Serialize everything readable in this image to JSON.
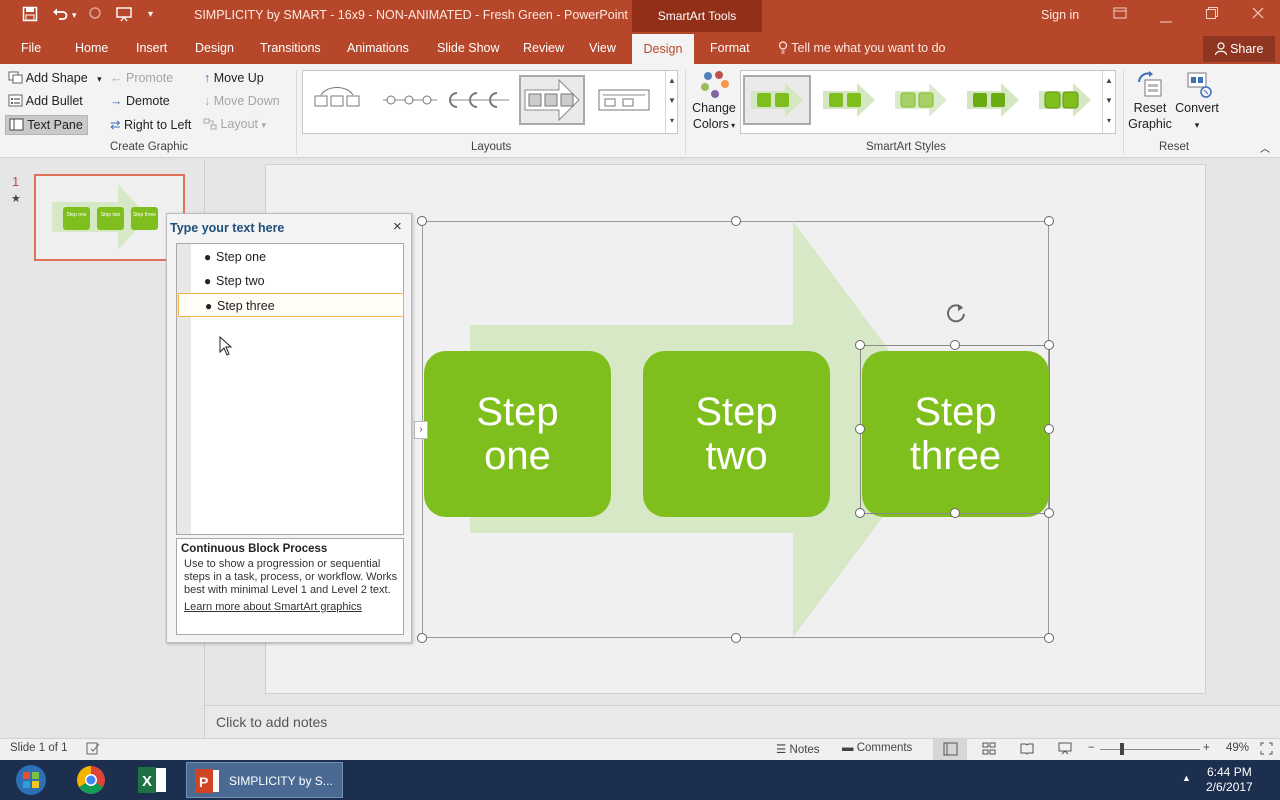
{
  "window": {
    "title": "SIMPLICITY by SMART - 16x9 - NON-ANIMATED - Fresh Green  -  PowerPoint",
    "context_tools": "SmartArt Tools",
    "sign_in": "Sign in",
    "accent_color": "#b7472a"
  },
  "tabs": {
    "file": "File",
    "home": "Home",
    "insert": "Insert",
    "design": "Design",
    "transitions": "Transitions",
    "animations": "Animations",
    "slideshow": "Slide Show",
    "review": "Review",
    "view": "View",
    "smartart_design": "Design",
    "format": "Format",
    "tell_me": "Tell me what you want to do",
    "share": "Share"
  },
  "ribbon": {
    "create_graphic": {
      "label": "Create Graphic",
      "add_shape": "Add Shape",
      "add_bullet": "Add Bullet",
      "text_pane": "Text Pane",
      "promote": "Promote",
      "demote": "Demote",
      "right_to_left": "Right to Left",
      "move_up": "Move Up",
      "move_down": "Move Down",
      "layout": "Layout"
    },
    "layouts": {
      "label": "Layouts"
    },
    "smartart_styles": {
      "label": "SmartArt Styles",
      "change_colors_1": "Change",
      "change_colors_2": "Colors"
    },
    "reset": {
      "label": "Reset",
      "reset_graphic_1": "Reset",
      "reset_graphic_2": "Graphic",
      "convert": "Convert"
    }
  },
  "thumbnails": {
    "slide_number": "1",
    "star": "★",
    "boxes": [
      "Step one",
      "Step two",
      "Step three"
    ]
  },
  "smartart": {
    "steps": [
      {
        "line1": "Step",
        "line2": "one"
      },
      {
        "line1": "Step",
        "line2": "two"
      },
      {
        "line1": "Step",
        "line2": "three"
      }
    ],
    "fill_color": "#7fbf1d",
    "arrow_color": "#d6e8c6"
  },
  "text_pane": {
    "title": "Type your text here",
    "close": "×",
    "items": [
      "Step one",
      "Step two",
      "Step three"
    ],
    "layout_name": "Continuous Block Process",
    "layout_desc": "Use to show a progression or sequential steps in a task, process, or workflow. Works best with minimal Level 1 and Level 2 text.",
    "learn_more": "Learn more about SmartArt graphics"
  },
  "notes": {
    "placeholder": "Click to add notes"
  },
  "status_bar": {
    "slide_info": "Slide 1 of 1",
    "notes": "Notes",
    "comments": "Comments",
    "zoom": "49%"
  },
  "taskbar": {
    "powerpoint_label": "SIMPLICITY by S...",
    "time": "6:44 PM",
    "date": "2/6/2017"
  }
}
